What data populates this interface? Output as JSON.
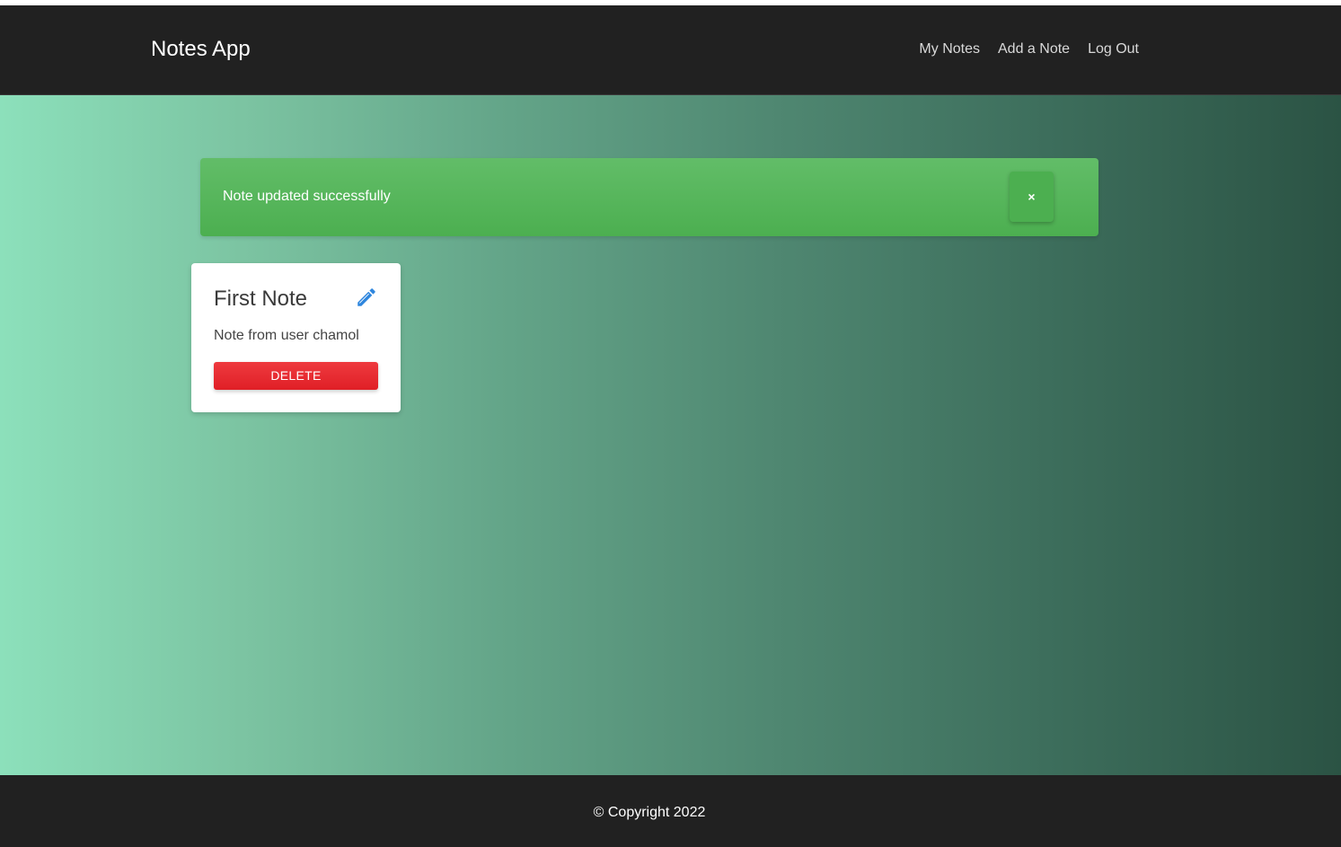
{
  "navbar": {
    "brand": "Notes App",
    "links": [
      "My Notes",
      "Add a Note",
      "Log Out"
    ]
  },
  "alert": {
    "message": "Note updated successfully",
    "close_label": "×"
  },
  "notes": [
    {
      "title": "First Note",
      "body": "Note from user chamol",
      "delete_label": "DELETE",
      "edit_icon": "pencil-icon"
    }
  ],
  "footer": {
    "text": "© Copyright 2022"
  },
  "colors": {
    "navbar_bg": "#212121",
    "alert_bg": "#4caf50",
    "delete_bg": "#e01f26",
    "edit_icon": "#2e86de",
    "gradient_start": "#8ce0bb",
    "gradient_end": "#2b5344"
  }
}
